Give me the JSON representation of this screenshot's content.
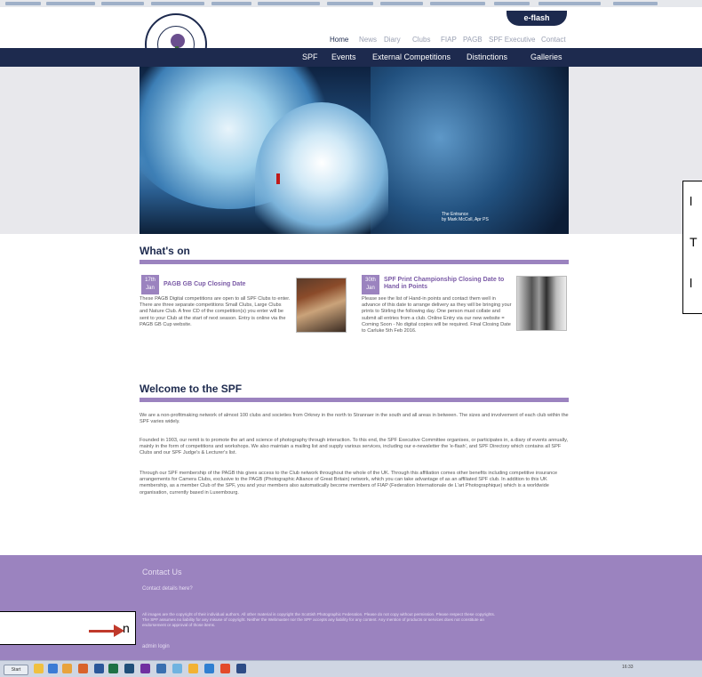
{
  "eflash": {
    "label": "e-flash"
  },
  "topnav": [
    "Home",
    "News",
    "Diary",
    "Clubs",
    "FIAP",
    "PAGB",
    "SPF Executive",
    "Contact"
  ],
  "mainnav": [
    "SPF",
    "Events",
    "External Competitions",
    "Distinctions",
    "Galleries"
  ],
  "hero": {
    "caption": "The Entrance\nby Mark McColl, Apr PS"
  },
  "whats_on": {
    "title": "What's on",
    "events": [
      {
        "date": "17th Jan",
        "title": "PAGB GB Cup Closing Date",
        "body": "These PAGB Digital competitions are open to all SPF Clubs to enter. There are three separate competitions Small Clubs, Large Clubs and Nature Club. A free CD of the competition(s) you enter will be sent to your Club at the start of next season. Entry is online via the PAGB GB Cup website."
      },
      {
        "date": "30th Jan",
        "title": "SPF Print Championship Closing Date to Hand in Points",
        "body": "Please see the list of Hand-in points and contact them well in advance of this date to arrange delivery as they will be bringing your prints to Stirling the following day. One person must collate and submit all entries from a club. Online Entry via our new website = Coming Soon - No digital copies will be required. Final Closing Date to Carluke 5th Feb 2016."
      }
    ]
  },
  "welcome": {
    "title": "Welcome to the SPF",
    "paragraphs": [
      "We are a non-profitmaking network of almost 100 clubs and societies from Orkney in the north to Stranraer in the south and all areas in between. The sizes and involvement of each club within the SPF varies widely.",
      "Founded in 1903, our remit is to promote the art and science of photography through interaction. To this end, the SPF Executive Committee organises, or participates in, a diary of events annually, mainly in the form of competitions and workshops. We also maintain a mailing list and supply various services, including our e-newsletter the 'e-flash', and SPF Directory which contains all SPF Clubs and our SPF Judge's & Lecturer's list.",
      "Through our SPF membership of the PAGB this gives access to the Club network throughout the whole of the UK. Through this affiliation comes other benefits including competitive insurance arrangements for Camera Clubs, exclusive to the PAGB (Photographic Alliance of Great Britain) network, which you can take advantage of as an affiliated SPF club. In addition to this UK membership, as a member Club of the SPF, you and your members also automatically become members of FIAP (Federation Internationale de L'art Photographique) which is a worldwide organisation, currently based in Luxembourg."
    ]
  },
  "footer": {
    "contact_heading": "Contact Us",
    "contact_link": "Contact details here?",
    "legal": "All images are the copyright of their individual authors. All other material is copyright the Scottish Photographic Federation. Please do not copy without permission. Please respect these copyrights. The SPF assumes no liability for any misuse of copyright. Neither the Webmaster nor the SPF accepts any liability for any content. Any mention of products or services does not constitute an endorsement or approval of those items.",
    "admin": "admin login"
  },
  "callouts": {
    "right_lines": [
      "l",
      "T",
      "l"
    ],
    "left": "n"
  },
  "taskbar": {
    "start": "Start",
    "tray_time": "16:33"
  },
  "colors": {
    "navy": "#1d2a4e",
    "purple": "#9b83bf",
    "arrow": "#c0392b"
  }
}
